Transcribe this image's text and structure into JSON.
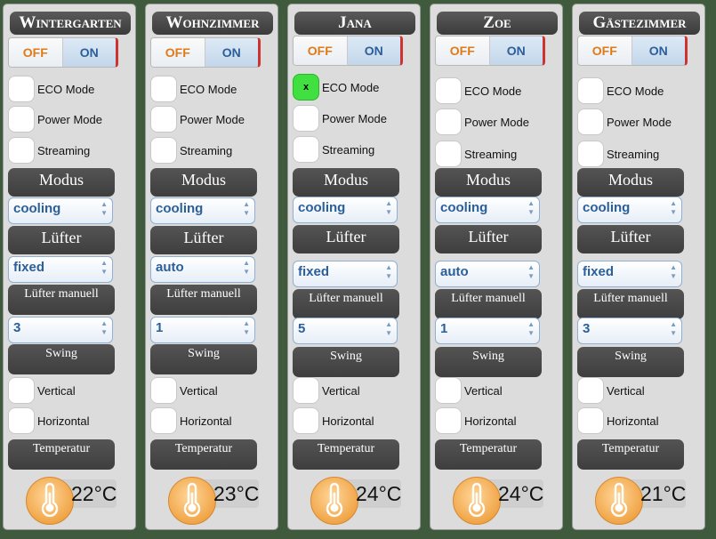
{
  "labels": {
    "off": "OFF",
    "on": "ON",
    "eco": "ECO Mode",
    "power": "Power Mode",
    "streaming": "Streaming",
    "modus": "Modus",
    "luefter": "Lüfter",
    "luefter_manuell": "Lüfter manuell",
    "swing": "Swing",
    "vertical": "Vertical",
    "horizontal": "Horizontal",
    "temperatur": "Temperatur",
    "check_mark": "x"
  },
  "icons": {
    "thermometer": "thermometer-icon",
    "select_arrow": "chevron-updown-icon"
  },
  "colors": {
    "background": "#3f5a3c",
    "off_text": "#e07a18",
    "on_text": "#2b5f9a",
    "checked": "#3fe03f"
  },
  "rooms": [
    {
      "name": "Wintergarten",
      "eco": false,
      "modus": "cooling",
      "luefter": "fixed",
      "luefter_manuell": "3",
      "temperature": "22°C"
    },
    {
      "name": "Wohnzimmer",
      "eco": false,
      "modus": "cooling",
      "luefter": "auto",
      "luefter_manuell": "1",
      "temperature": "23°C"
    },
    {
      "name": "Jana",
      "eco": true,
      "modus": "cooling",
      "luefter": "fixed",
      "luefter_manuell": "5",
      "temperature": "24°C"
    },
    {
      "name": "Zoe",
      "eco": false,
      "modus": "cooling",
      "luefter": "auto",
      "luefter_manuell": "1",
      "temperature": "24°C"
    },
    {
      "name": "Gästezimmer",
      "eco": false,
      "modus": "cooling",
      "luefter": "fixed",
      "luefter_manuell": "3",
      "temperature": "21°C"
    }
  ]
}
